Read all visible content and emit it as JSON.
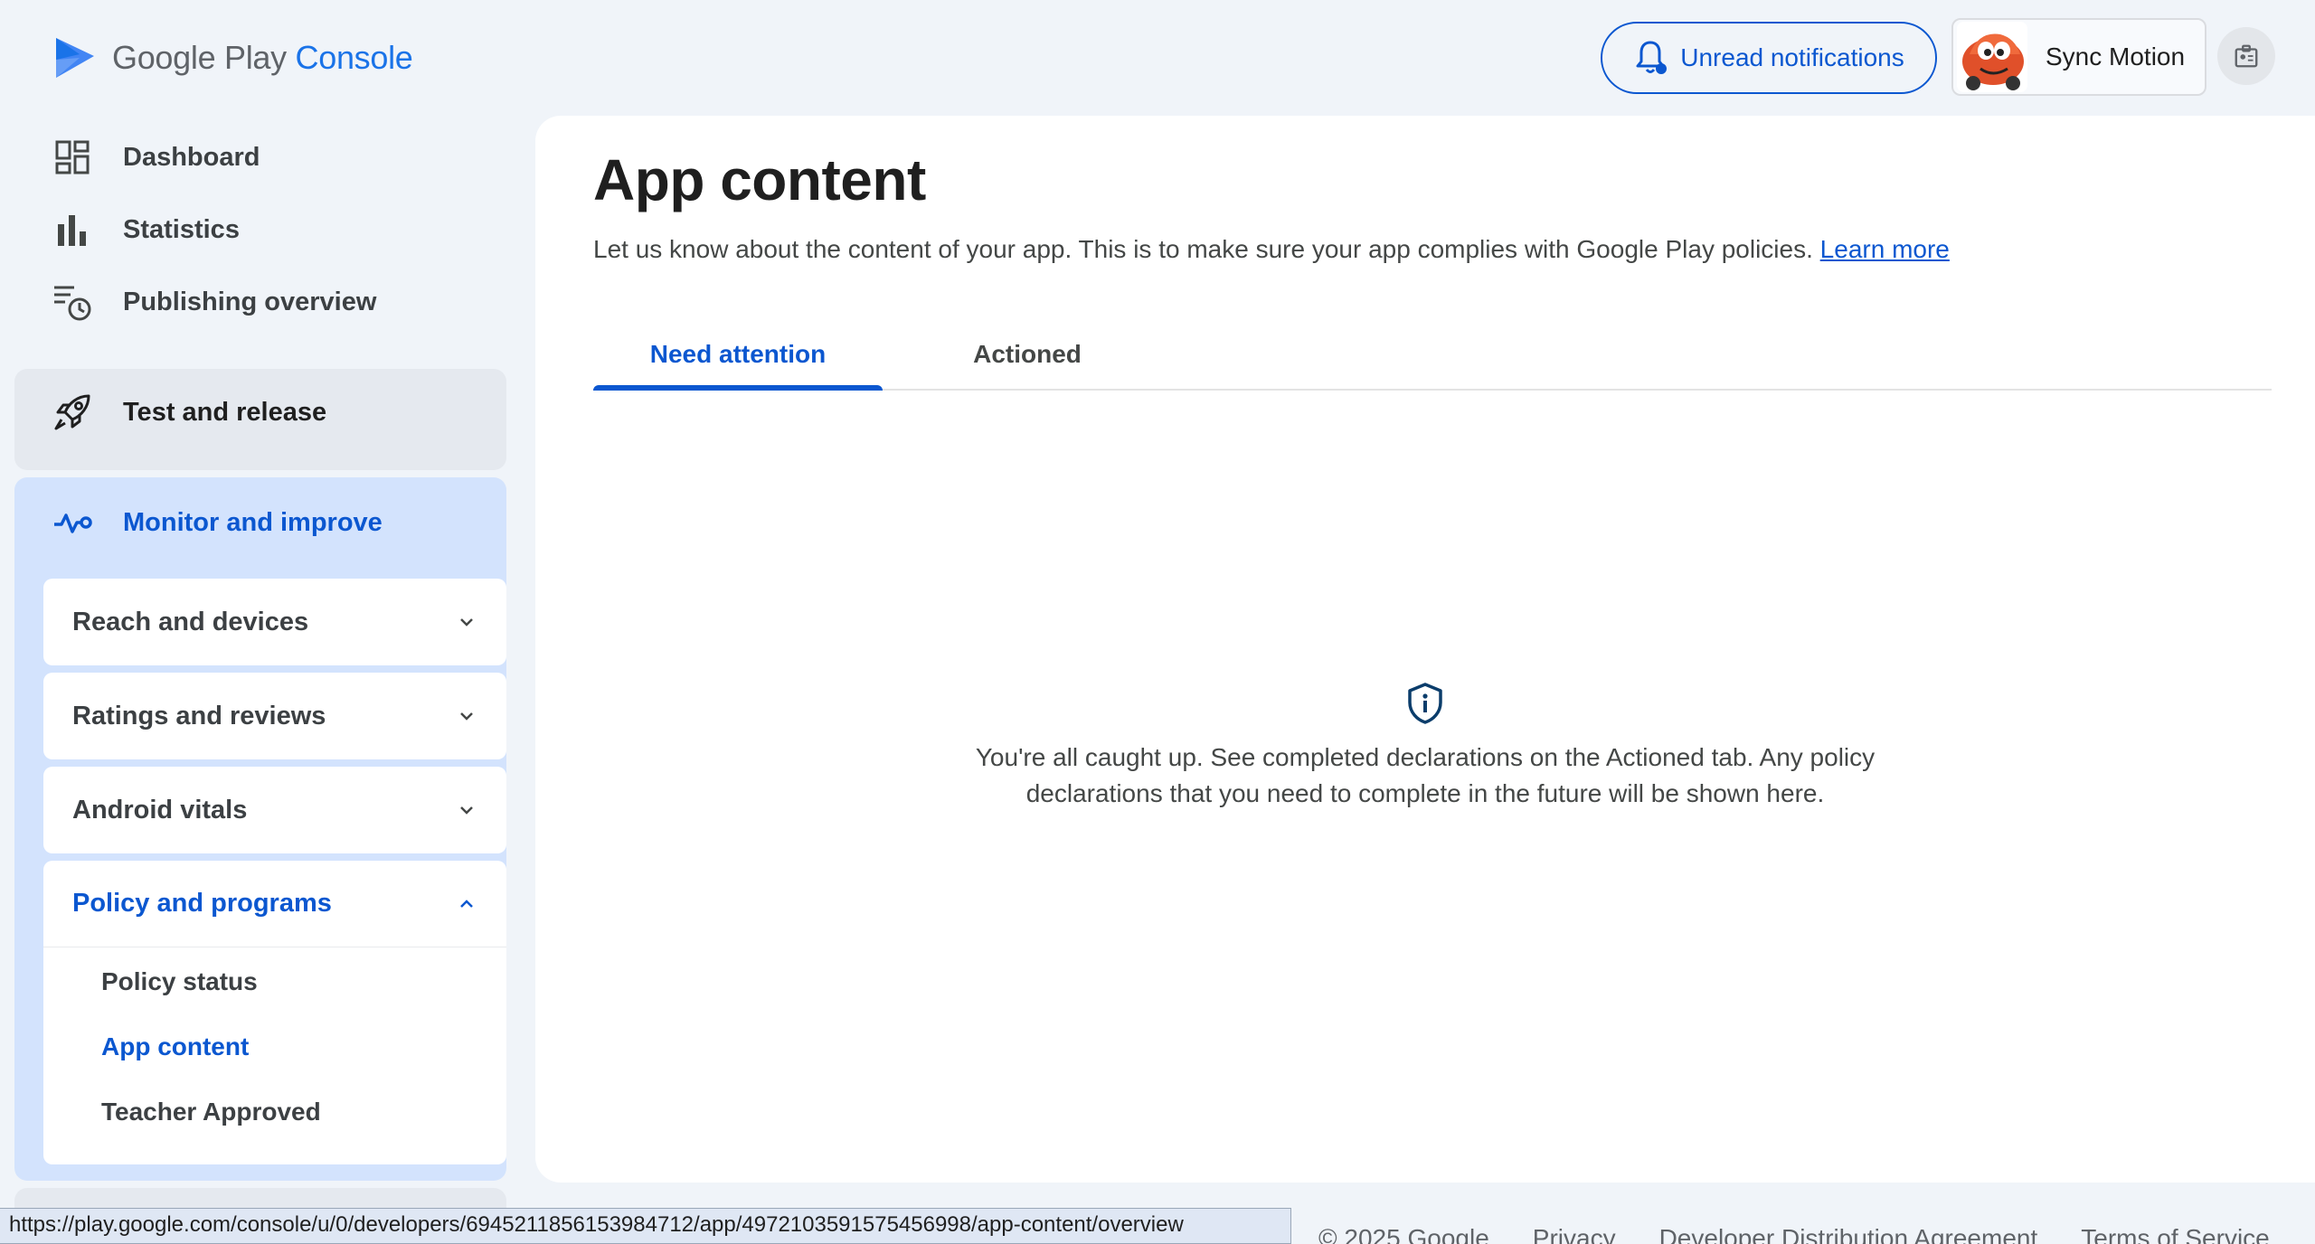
{
  "header": {
    "logo_text": "Google Play",
    "logo_console": "Console",
    "notifications_label": "Unread notifications",
    "account_name": "Sync Motion"
  },
  "sidebar": {
    "top_items": [
      {
        "label": "Dashboard",
        "icon": "dashboard-icon"
      },
      {
        "label": "Statistics",
        "icon": "bar-chart-icon"
      },
      {
        "label": "Publishing overview",
        "icon": "publishing-history-icon"
      }
    ],
    "test_and_release": {
      "label": "Test and release",
      "icon": "rocket-icon"
    },
    "monitor_and_improve": {
      "label": "Monitor and improve",
      "icon": "pulse-icon"
    },
    "groups": [
      {
        "label": "Reach and devices",
        "state": "collapsed"
      },
      {
        "label": "Ratings and reviews",
        "state": "collapsed"
      },
      {
        "label": "Android vitals",
        "state": "collapsed"
      },
      {
        "label": "Policy and programs",
        "state": "expanded"
      }
    ],
    "policy_sub_items": [
      {
        "label": "Policy status",
        "active": false
      },
      {
        "label": "App content",
        "active": true
      },
      {
        "label": "Teacher Approved",
        "active": false
      }
    ]
  },
  "main": {
    "title": "App content",
    "description": "Let us know about the content of your app. This is to make sure your app complies with Google Play policies.",
    "learn_more": "Learn more",
    "tabs": [
      {
        "label": "Need attention",
        "active": true
      },
      {
        "label": "Actioned",
        "active": false
      }
    ],
    "empty_state": {
      "icon": "shield-info-icon",
      "message": "You're all caught up. See completed declarations on the Actioned tab. Any policy declarations that you need to complete in the future will be shown here."
    }
  },
  "footer": {
    "copyright": "© 2025 Google",
    "links": [
      "Privacy",
      "Developer Distribution Agreement",
      "Terms of Service"
    ]
  },
  "status_bar": {
    "url": "https://play.google.com/console/u/0/developers/6945211856153984712/app/4972103591575456998/app-content/overview"
  },
  "colors": {
    "accent": "#0b57d0",
    "sidebar_active_bg": "#d3e3fd",
    "page_bg": "#f0f4f9"
  }
}
